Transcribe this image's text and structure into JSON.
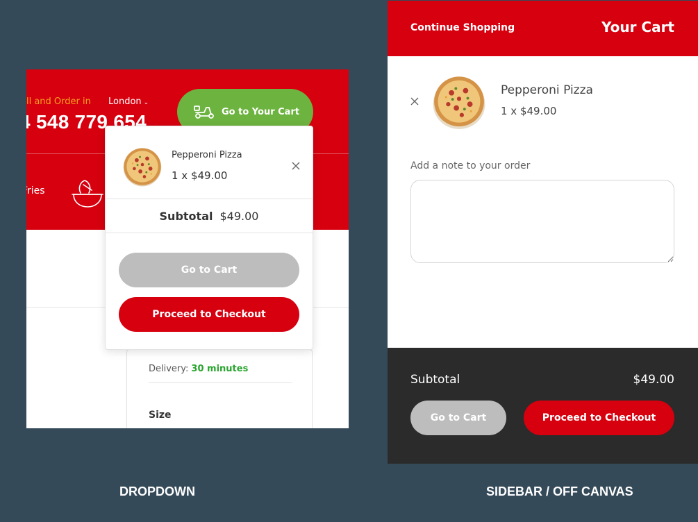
{
  "dropdown_demo": {
    "header": {
      "call_text": "all and Order in",
      "city": "London",
      "phone": "4 548 779 654",
      "go_cart_label": "Go to Your Cart",
      "nav_item": "Fries"
    },
    "product": {
      "delivery_label": "Delivery:",
      "delivery_value": "30 minutes",
      "size_label": "Size"
    },
    "dropdown": {
      "item_name": "Pepperoni Pizza",
      "item_qty": "1 x $49.00",
      "subtotal_label": "Subtotal",
      "subtotal_value": "$49.00",
      "go_to_cart": "Go to Cart",
      "checkout": "Proceed to Checkout"
    },
    "caption": "DROPDOWN"
  },
  "sidebar_demo": {
    "continue_shopping": "Continue Shopping",
    "title": "Your Cart",
    "item_name": "Pepperoni Pizza",
    "item_qty": "1 x $49.00",
    "note_label": "Add a note to your order",
    "note_value": "",
    "subtotal_label": "Subtotal",
    "subtotal_value": "$49.00",
    "go_to_cart": "Go to Cart",
    "checkout": "Proceed to Checkout",
    "caption": "SIDEBAR / OFF CANVAS"
  },
  "colors": {
    "brand_red": "#d6000f",
    "green": "#6db33f",
    "gray_button": "#bdbdbd",
    "page_bg": "#354a59",
    "dark_footer": "#2b2b2b",
    "accent_orange": "#f6a21e",
    "delivery_green": "#2aa52f"
  },
  "icons": [
    "scooter-icon",
    "chevron-down-icon",
    "bowl-icon",
    "pizza-thumbnail",
    "close-icon"
  ]
}
